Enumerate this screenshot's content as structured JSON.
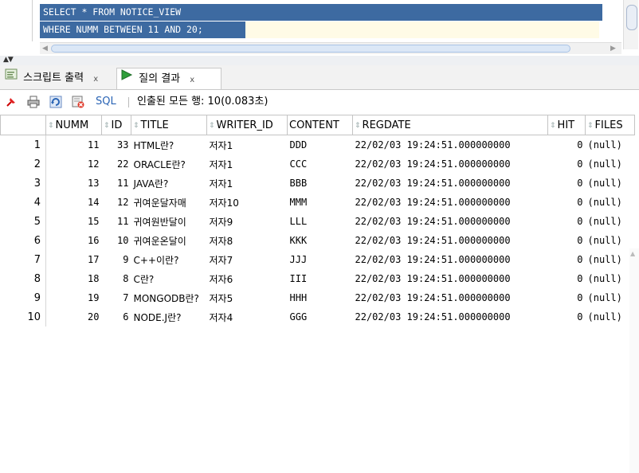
{
  "editor": {
    "line1": "SELECT * FROM NOTICE_VIEW",
    "line2": "WHERE NUMM BETWEEN 11 AND 20;"
  },
  "tabs": [
    {
      "label": "스크립트 출력",
      "icon": "script-output-icon"
    },
    {
      "label": "질의 결과",
      "icon": "run-play-icon"
    }
  ],
  "toolbar": {
    "sql_label": "SQL",
    "status": "인출된 모든 행: 10(0.083초)"
  },
  "grid": {
    "columns": [
      "NUMM",
      "ID",
      "TITLE",
      "WRITER_ID",
      "CONTENT",
      "REGDATE",
      "HIT",
      "FILES"
    ],
    "rows": [
      {
        "n": "1",
        "numm": "11",
        "id": "33",
        "title": "HTML란?",
        "writer": "저자1",
        "content": "DDD",
        "regdate": "22/02/03 19:24:51.000000000",
        "hit": "0",
        "files": "(null)"
      },
      {
        "n": "2",
        "numm": "12",
        "id": "22",
        "title": "ORACLE란?",
        "writer": "저자1",
        "content": "CCC",
        "regdate": "22/02/03 19:24:51.000000000",
        "hit": "0",
        "files": "(null)"
      },
      {
        "n": "3",
        "numm": "13",
        "id": "11",
        "title": "JAVA란?",
        "writer": "저자1",
        "content": "BBB",
        "regdate": "22/02/03 19:24:51.000000000",
        "hit": "0",
        "files": "(null)"
      },
      {
        "n": "4",
        "numm": "14",
        "id": "12",
        "title": "귀여운달자매",
        "writer": "저자10",
        "content": "MMM",
        "regdate": "22/02/03 19:24:51.000000000",
        "hit": "0",
        "files": "(null)"
      },
      {
        "n": "5",
        "numm": "15",
        "id": "11",
        "title": "귀여원반달이",
        "writer": "저자9",
        "content": "LLL",
        "regdate": "22/02/03 19:24:51.000000000",
        "hit": "0",
        "files": "(null)"
      },
      {
        "n": "6",
        "numm": "16",
        "id": "10",
        "title": "귀여운온달이",
        "writer": "저자8",
        "content": "KKK",
        "regdate": "22/02/03 19:24:51.000000000",
        "hit": "0",
        "files": "(null)"
      },
      {
        "n": "7",
        "numm": "17",
        "id": "9",
        "title": "C++이란?",
        "writer": "저자7",
        "content": "JJJ",
        "regdate": "22/02/03 19:24:51.000000000",
        "hit": "0",
        "files": "(null)"
      },
      {
        "n": "8",
        "numm": "18",
        "id": "8",
        "title": "C란?",
        "writer": "저자6",
        "content": "III",
        "regdate": "22/02/03 19:24:51.000000000",
        "hit": "0",
        "files": "(null)"
      },
      {
        "n": "9",
        "numm": "19",
        "id": "7",
        "title": "MONGODB란?",
        "writer": "저자5",
        "content": "HHH",
        "regdate": "22/02/03 19:24:51.000000000",
        "hit": "0",
        "files": "(null)"
      },
      {
        "n": "10",
        "numm": "20",
        "id": "6",
        "title": "NODE.J란?",
        "writer": "저자4",
        "content": "GGG",
        "regdate": "22/02/03 19:24:51.000000000",
        "hit": "0",
        "files": "(null)"
      }
    ]
  }
}
